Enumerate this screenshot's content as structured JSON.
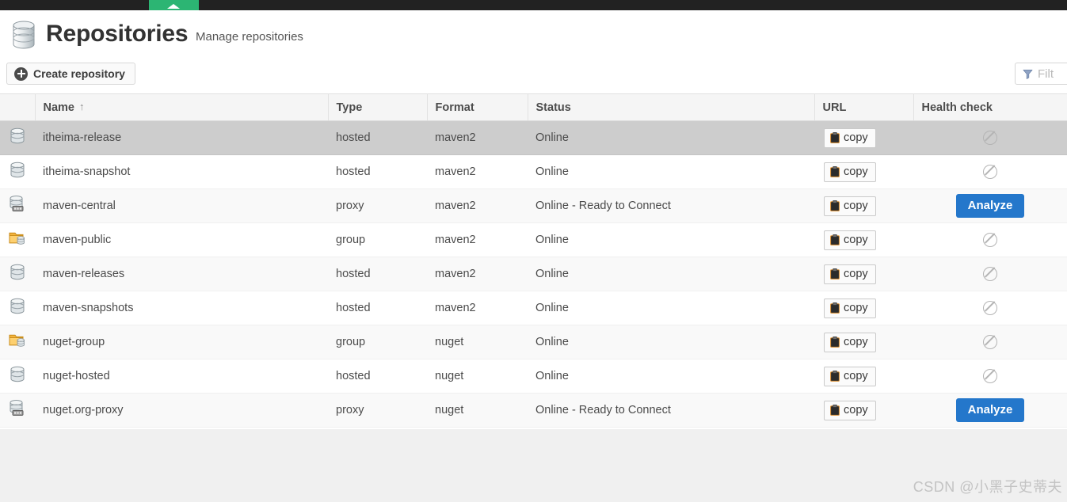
{
  "browser_bar": {
    "accent_color": "#2cb573",
    "bar_color": "#222222",
    "caret_icon": "chevron-up-icon"
  },
  "header": {
    "icon": "database-icon",
    "title": "Repositories",
    "subtitle": "Manage repositories"
  },
  "toolbar": {
    "create_label": "Create repository",
    "create_icon": "plus-circle-icon",
    "filter_icon": "funnel-icon",
    "filter_placeholder": "Filt"
  },
  "table": {
    "columns": [
      {
        "key": "icon",
        "label": ""
      },
      {
        "key": "name",
        "label": "Name",
        "sort": "↑"
      },
      {
        "key": "type",
        "label": "Type"
      },
      {
        "key": "format",
        "label": "Format"
      },
      {
        "key": "status",
        "label": "Status"
      },
      {
        "key": "url",
        "label": "URL"
      },
      {
        "key": "health",
        "label": "Health check"
      }
    ],
    "copy_label": "copy",
    "copy_icon": "clipboard-icon",
    "analyze_label": "Analyze",
    "blocked_icon": "no-entry-icon",
    "rows": [
      {
        "icon": "database-hosted-icon",
        "name": "itheima-release",
        "type": "hosted",
        "format": "maven2",
        "status": "Online",
        "url": "copy",
        "health": "blocked",
        "highlighted": true
      },
      {
        "icon": "database-hosted-icon",
        "name": "itheima-snapshot",
        "type": "hosted",
        "format": "maven2",
        "status": "Online",
        "url": "copy",
        "health": "blocked",
        "highlighted": false
      },
      {
        "icon": "database-proxy-icon",
        "name": "maven-central",
        "type": "proxy",
        "format": "maven2",
        "status": "Online - Ready to Connect",
        "url": "copy",
        "health": "analyze",
        "highlighted": false
      },
      {
        "icon": "folder-group-icon",
        "name": "maven-public",
        "type": "group",
        "format": "maven2",
        "status": "Online",
        "url": "copy",
        "health": "blocked",
        "highlighted": false
      },
      {
        "icon": "database-hosted-icon",
        "name": "maven-releases",
        "type": "hosted",
        "format": "maven2",
        "status": "Online",
        "url": "copy",
        "health": "blocked",
        "highlighted": false
      },
      {
        "icon": "database-hosted-icon",
        "name": "maven-snapshots",
        "type": "hosted",
        "format": "maven2",
        "status": "Online",
        "url": "copy",
        "health": "blocked",
        "highlighted": false
      },
      {
        "icon": "folder-group-icon",
        "name": "nuget-group",
        "type": "group",
        "format": "nuget",
        "status": "Online",
        "url": "copy",
        "health": "blocked",
        "highlighted": false
      },
      {
        "icon": "database-hosted-icon",
        "name": "nuget-hosted",
        "type": "hosted",
        "format": "nuget",
        "status": "Online",
        "url": "copy",
        "health": "blocked",
        "highlighted": false
      },
      {
        "icon": "database-proxy-icon",
        "name": "nuget.org-proxy",
        "type": "proxy",
        "format": "nuget",
        "status": "Online - Ready to Connect",
        "url": "copy",
        "health": "analyze",
        "highlighted": false
      }
    ]
  },
  "footer": {
    "watermark": "CSDN @小黑子史蒂夫"
  },
  "colors": {
    "accent_green": "#2cb573",
    "analyze_blue": "#2477cb",
    "row_highlight": "#cdcdcd",
    "row_alt": "#f9f9f9"
  }
}
